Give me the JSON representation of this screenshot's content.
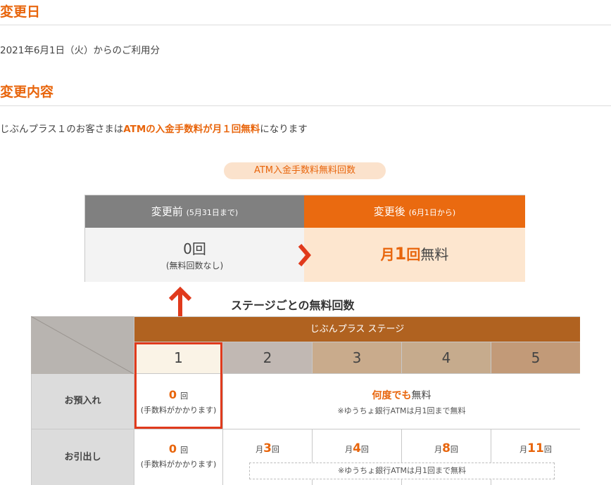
{
  "section1": {
    "heading": "変更日",
    "text": "2021年6月1日（火）からのご利用分"
  },
  "section2": {
    "heading": "変更内容",
    "text_before": "じぶんプラス１のお客さまは",
    "text_highlight": "ATMの入金手数料が月１回無料",
    "text_after": "になります"
  },
  "comparison": {
    "pill": "ATM入金手数料無料回数",
    "before": {
      "label": "変更前",
      "date": "(5月31日まで)",
      "value": "0回",
      "note": "(無料回数なし)"
    },
    "after": {
      "label": "変更後",
      "date": "(6月1日から)",
      "prefix": "月",
      "count": "1",
      "unit": "回",
      "suffix": "無料"
    }
  },
  "stage_table": {
    "title": "ステージごとの無料回数",
    "band_label": "じぶんプラス ステージ",
    "stages": [
      "1",
      "2",
      "3",
      "4",
      "5"
    ],
    "stage_colors": [
      "#faf3e6",
      "#c1b8b3",
      "#c9ab8c",
      "#c6ab8d",
      "#c29a78"
    ],
    "deposit": {
      "label": "お預入れ",
      "stage1": {
        "count": "0",
        "unit": "回",
        "note": "(手数料がかかります)"
      },
      "others": {
        "highlight": "何度でも",
        "text": "無料",
        "note": "※ゆうちょ銀行ATMは月1回まで無料"
      }
    },
    "withdraw": {
      "label": "お引出し",
      "stage1": {
        "count": "0",
        "unit": "回",
        "note": "(手数料がかかります)"
      },
      "cells": [
        {
          "prefix": "月",
          "count": "3",
          "unit": "回"
        },
        {
          "prefix": "月",
          "count": "4",
          "unit": "回"
        },
        {
          "prefix": "月",
          "count": "8",
          "unit": "回"
        },
        {
          "prefix": "月",
          "count": "11",
          "unit": "回"
        }
      ],
      "note": "※ゆうちょ銀行ATMは月1回まで無料"
    }
  },
  "colors": {
    "accent": "#e8650c",
    "band": "#b06220",
    "highlight_frame": "#e03a1c"
  }
}
